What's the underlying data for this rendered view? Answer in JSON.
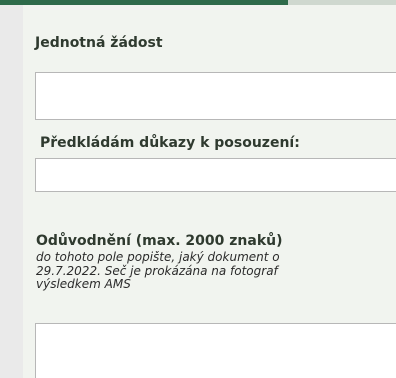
{
  "form": {
    "section_title": "Jednotná žádost",
    "field_1": {
      "value": "",
      "placeholder": ""
    },
    "evidence_label": "Předkládám důkazy k posouzení:",
    "field_2": {
      "value": "",
      "placeholder": ""
    },
    "justification": {
      "label": "Odůvodnění (max. 2000 znaků)",
      "hint_lines": [
        "do tohoto pole popište, jaký dokument o",
        "29.7.2022. Seč je prokázána na fotograf",
        "výsledkem AMS"
      ],
      "value": "",
      "placeholder": ""
    }
  },
  "colors": {
    "accent": "#2e6b4a",
    "accent_light": "#cfd8cf",
    "panel_bg": "#f1f4ef",
    "left_strip": "#eaeaea"
  }
}
